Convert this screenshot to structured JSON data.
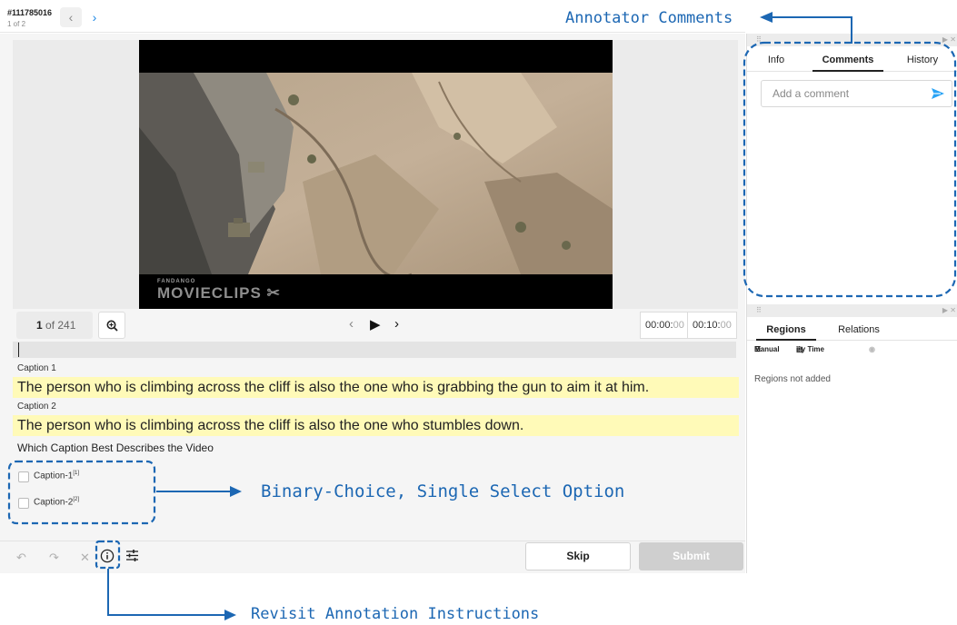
{
  "header": {
    "task_id": "#111785016",
    "task_count": "1 of 2",
    "prev_icon": "chevron-left-icon",
    "next_icon": "chevron-right-icon"
  },
  "video": {
    "watermark_small": "FANDANGO",
    "watermark": "MOVIECLIPS",
    "frame_current": "1",
    "frame_total": " of 241",
    "time_current_main": "00:00:",
    "time_current_ms": "00",
    "time_duration_main": "00:10:",
    "time_duration_ms": "00"
  },
  "captions": [
    {
      "label": "Caption 1",
      "text": "The person who is climbing across the cliff is also the one who is grabbing the gun to aim it at him."
    },
    {
      "label": "Caption 2",
      "text": "The person who is climbing across the cliff is also the one who stumbles down."
    }
  ],
  "question": "Which Caption Best Describes the Video",
  "choices": [
    {
      "label": "Caption-1",
      "hotkey": "[1]",
      "checked": false
    },
    {
      "label": "Caption-2",
      "hotkey": "[2]",
      "checked": false
    }
  ],
  "bottom_bar": {
    "skip_label": "Skip",
    "submit_label": "Submit"
  },
  "side_panel": {
    "tabs": [
      "Info",
      "Comments",
      "History"
    ],
    "active_tab": "Comments",
    "comment_placeholder": "Add a comment",
    "region_tabs": [
      "Regions",
      "Relations"
    ],
    "active_region_tab": "Regions",
    "manual_label": "Manual",
    "by_time_label": "By Time",
    "regions_empty": "Regions not added"
  },
  "annotations": {
    "comments_callout": "Annotator Comments",
    "choice_callout": "Binary-Choice, Single Select Option",
    "instructions_callout": "Revisit Annotation Instructions"
  },
  "colors": {
    "callout": "#1c67b3",
    "caption_highlight": "#fffab8",
    "link_blue": "#1e88e5",
    "send_blue": "#29a3f5"
  }
}
